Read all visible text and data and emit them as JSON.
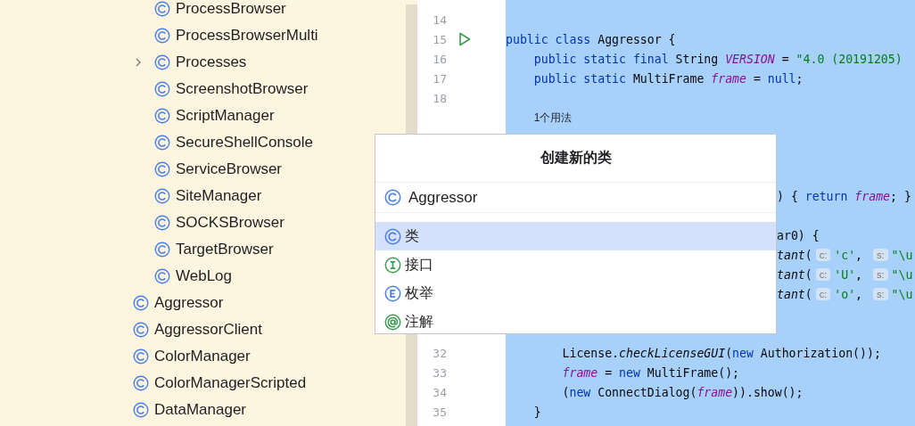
{
  "project_tree": {
    "nested_items": [
      {
        "label": "ProcessBrowser"
      },
      {
        "label": "ProcessBrowserMulti"
      },
      {
        "label": "Processes",
        "expanded": false
      },
      {
        "label": "ScreenshotBrowser"
      },
      {
        "label": "ScriptManager"
      },
      {
        "label": "SecureShellConsole"
      },
      {
        "label": "ServiceBrowser"
      },
      {
        "label": "SiteManager"
      },
      {
        "label": "SOCKSBrowser"
      },
      {
        "label": "TargetBrowser"
      },
      {
        "label": "WebLog"
      }
    ],
    "items": [
      {
        "label": "Aggressor"
      },
      {
        "label": "AggressorClient"
      },
      {
        "label": "ColorManager"
      },
      {
        "label": "ColorManagerScripted"
      },
      {
        "label": "DataManager"
      }
    ]
  },
  "editor": {
    "lines": [
      {
        "kind": "blank",
        "number": "14"
      },
      {
        "kind": "code",
        "number": "15",
        "run_marker": true,
        "tokens": [
          {
            "kind": "kw",
            "text": "public class"
          },
          {
            "kind": "plain",
            "text": " Aggressor {"
          }
        ]
      },
      {
        "kind": "code",
        "number": "16",
        "run_marker": false,
        "tokens": [
          {
            "kind": "kw",
            "text": "    public static final"
          },
          {
            "kind": "plain",
            "text": " String "
          },
          {
            "kind": "field",
            "text": "VERSION"
          },
          {
            "kind": "plain",
            "text": " = "
          },
          {
            "kind": "str",
            "text": "\"4.0 (20191205)"
          }
        ]
      },
      {
        "kind": "code",
        "number": "17",
        "run_marker": false,
        "tokens": [
          {
            "kind": "kw",
            "text": "    public static"
          },
          {
            "kind": "plain",
            "text": " MultiFrame "
          },
          {
            "kind": "field",
            "text": "frame"
          },
          {
            "kind": "plain",
            "text": " = "
          },
          {
            "kind": "kw",
            "text": "null"
          },
          {
            "kind": "plain",
            "text": ";"
          }
        ]
      },
      {
        "kind": "blank",
        "number": "18"
      },
      {
        "kind": "usage",
        "text": "1个用法"
      },
      {
        "kind": "hidden"
      },
      {
        "kind": "hidden"
      },
      {
        "kind": "hidden"
      },
      {
        "kind": "partial",
        "tokens": [
          {
            "kind": "plain",
            "text": ") { "
          },
          {
            "kind": "kw",
            "text": "return"
          },
          {
            "kind": "field",
            "text": " frame"
          },
          {
            "kind": "plain",
            "text": "; }"
          }
        ]
      },
      {
        "kind": "hidden"
      },
      {
        "kind": "partial",
        "tokens": [
          {
            "kind": "plain",
            "text": "ar0) {"
          }
        ]
      },
      {
        "kind": "partial",
        "tokens": [
          {
            "kind": "call",
            "text": "tant"
          },
          {
            "kind": "plain",
            "text": "("
          },
          {
            "kind": "hint",
            "text": "c:"
          },
          {
            "kind": "str",
            "text": "'c'"
          },
          {
            "kind": "plain",
            "text": ", "
          },
          {
            "kind": "hint",
            "text": "s:"
          },
          {
            "kind": "str",
            "text": "\"\\u"
          }
        ]
      },
      {
        "kind": "partial",
        "tokens": [
          {
            "kind": "call",
            "text": "tant"
          },
          {
            "kind": "plain",
            "text": "("
          },
          {
            "kind": "hint",
            "text": "c:"
          },
          {
            "kind": "str",
            "text": "'U'"
          },
          {
            "kind": "plain",
            "text": ", "
          },
          {
            "kind": "hint",
            "text": "s:"
          },
          {
            "kind": "str",
            "text": "\"\\u"
          }
        ]
      },
      {
        "kind": "partial",
        "tokens": [
          {
            "kind": "call",
            "text": "tant"
          },
          {
            "kind": "plain",
            "text": "("
          },
          {
            "kind": "hint",
            "text": "c:"
          },
          {
            "kind": "str",
            "text": "'o'"
          },
          {
            "kind": "plain",
            "text": ", "
          },
          {
            "kind": "hint",
            "text": "s:"
          },
          {
            "kind": "str",
            "text": "\"\\u"
          }
        ]
      },
      {
        "kind": "hidden"
      },
      {
        "kind": "hidden"
      },
      {
        "kind": "code",
        "number": "32",
        "run_marker": false,
        "tokens": [
          {
            "kind": "plain",
            "text": "        License."
          },
          {
            "kind": "call",
            "text": "checkLicenseGUI"
          },
          {
            "kind": "plain",
            "text": "("
          },
          {
            "kind": "kw",
            "text": "new"
          },
          {
            "kind": "plain",
            "text": " Authorization());"
          }
        ]
      },
      {
        "kind": "code",
        "number": "33",
        "run_marker": false,
        "tokens": [
          {
            "kind": "field",
            "text": "        frame"
          },
          {
            "kind": "plain",
            "text": " = "
          },
          {
            "kind": "kw",
            "text": "new"
          },
          {
            "kind": "plain",
            "text": " MultiFrame();"
          }
        ]
      },
      {
        "kind": "code",
        "number": "34",
        "run_marker": false,
        "tokens": [
          {
            "kind": "plain",
            "text": "        ("
          },
          {
            "kind": "kw",
            "text": "new"
          },
          {
            "kind": "plain",
            "text": " ConnectDialog("
          },
          {
            "kind": "field",
            "text": "frame"
          },
          {
            "kind": "plain",
            "text": ")).show();"
          }
        ]
      },
      {
        "kind": "code",
        "number": "35",
        "run_marker": false,
        "tokens": [
          {
            "kind": "plain",
            "text": "    }"
          }
        ]
      }
    ]
  },
  "new_class_popup": {
    "title": "创建新的类",
    "name_field": {
      "value": "Aggressor"
    },
    "kinds": [
      {
        "kind": "class",
        "label": "类",
        "selected": true
      },
      {
        "kind": "interface",
        "label": "接口",
        "selected": false
      },
      {
        "kind": "enum",
        "label": "枚举",
        "selected": false
      },
      {
        "kind": "annotation",
        "label": "注解",
        "selected": false
      }
    ]
  }
}
